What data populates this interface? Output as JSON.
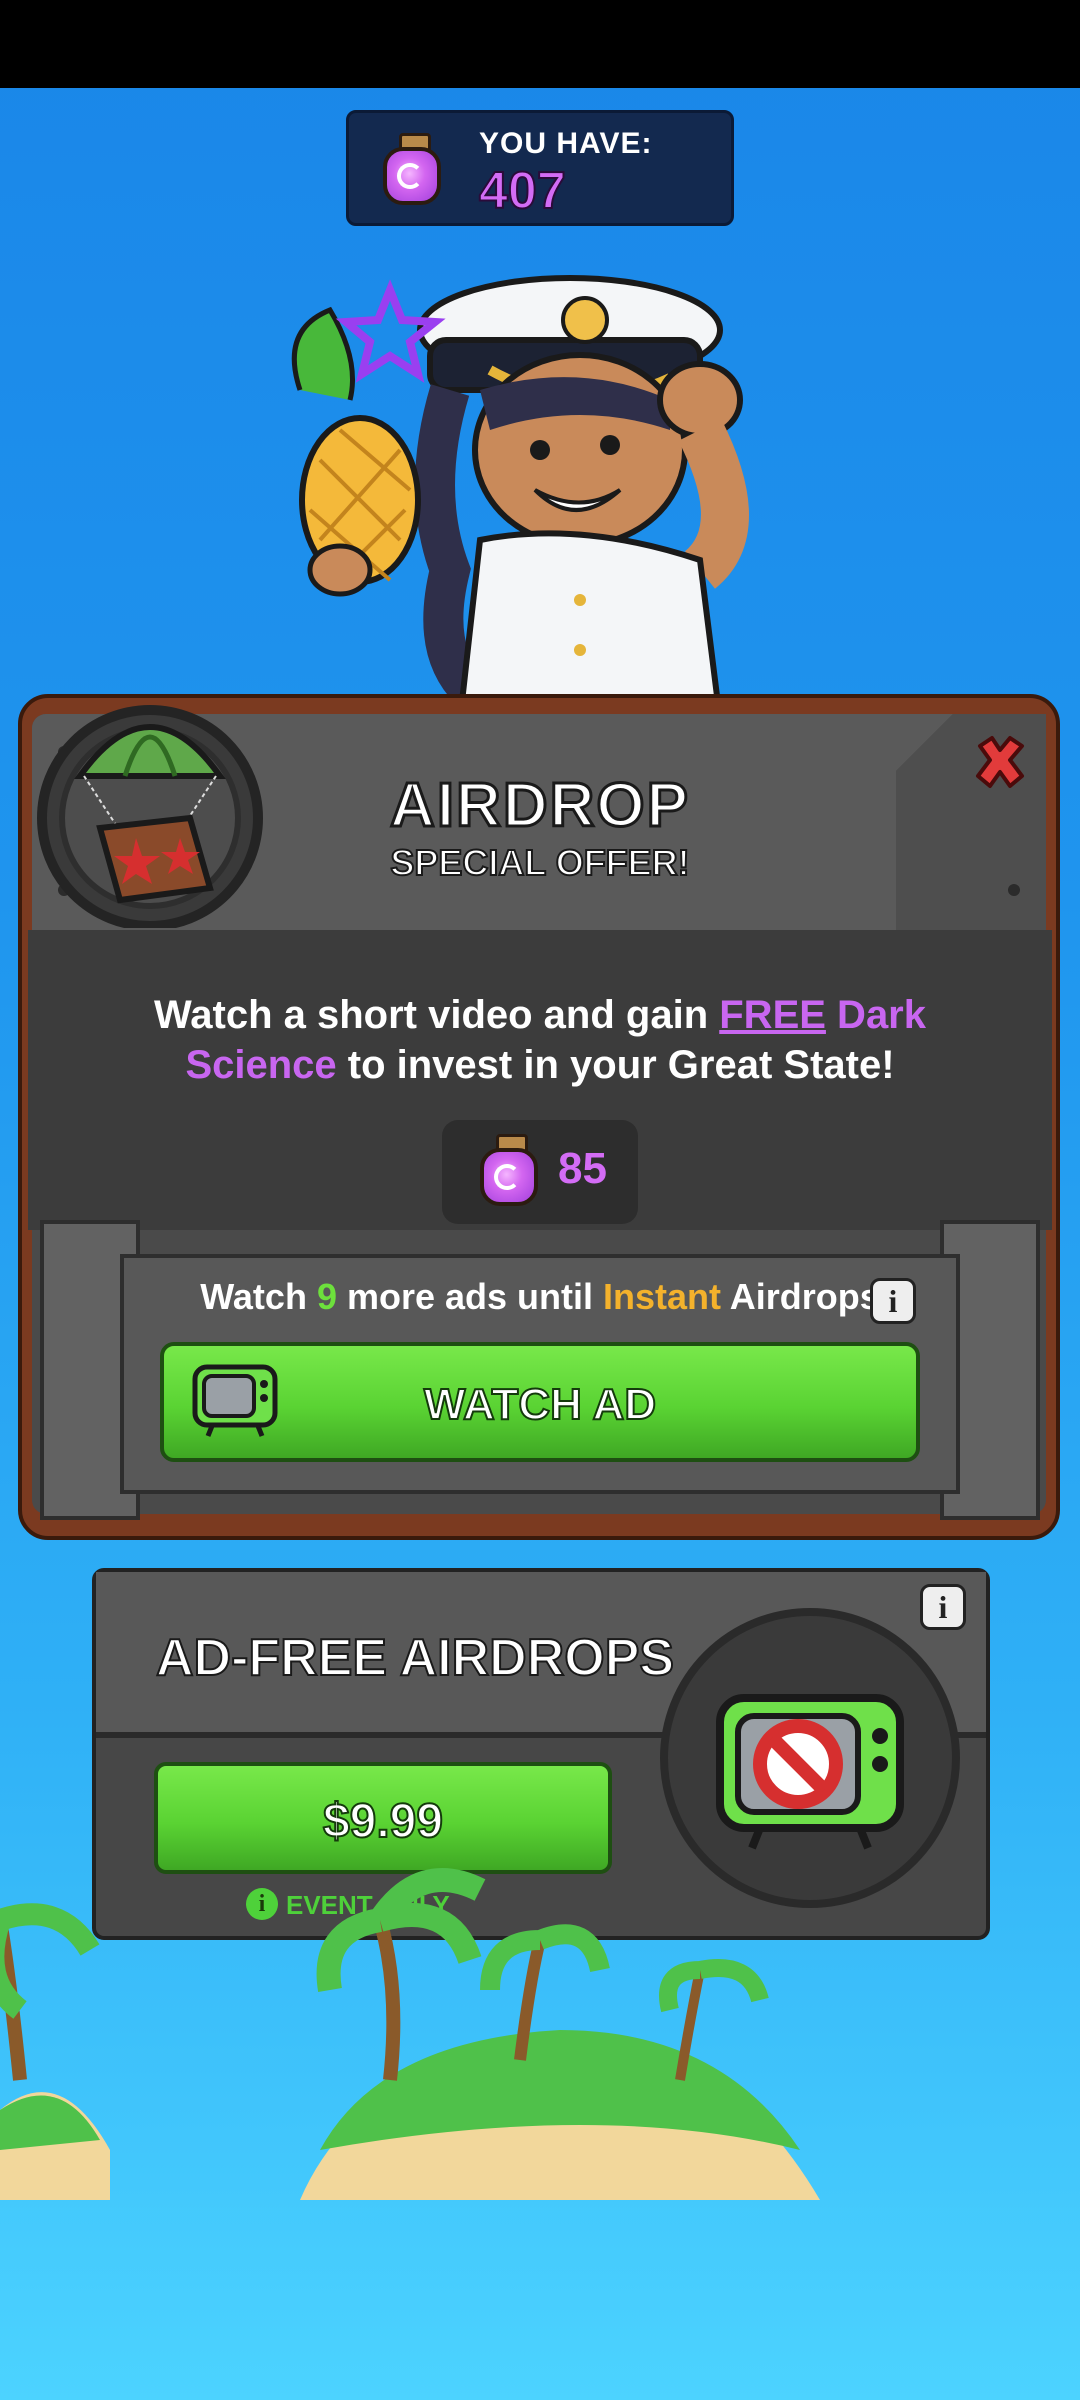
{
  "currency": {
    "label": "YOU HAVE:",
    "value": "407"
  },
  "offer": {
    "title": "AIRDROP",
    "subtitle": "SPECIAL OFFER!",
    "desc_part1": "Watch a short video and gain ",
    "desc_free": "FREE",
    "desc_dark": " Dark",
    "desc_science": "Science",
    "desc_part2": " to invest in your Great State!",
    "reward_value": "85"
  },
  "ad_progress": {
    "prefix": "Watch ",
    "count": "9",
    "middle": " more ads until ",
    "instant": "Instant",
    "suffix": " Airdrops",
    "info_icon_text": "i"
  },
  "watch_ad": {
    "label": "WATCH AD"
  },
  "ad_free": {
    "title": "AD-FREE AIRDROPS",
    "price": "$9.99",
    "event_note": "EVENT ONLY",
    "info_icon_text": "i"
  },
  "icons": [
    "dark-science-jar-icon",
    "close-icon",
    "parachute-crate-icon",
    "tv-icon",
    "no-ads-tv-icon",
    "info-icon"
  ],
  "colors": {
    "accent_purple": "#d36cf5",
    "green_button": "#5ad333",
    "instant_orange": "#f4b22c",
    "count_green": "#6de03c"
  }
}
